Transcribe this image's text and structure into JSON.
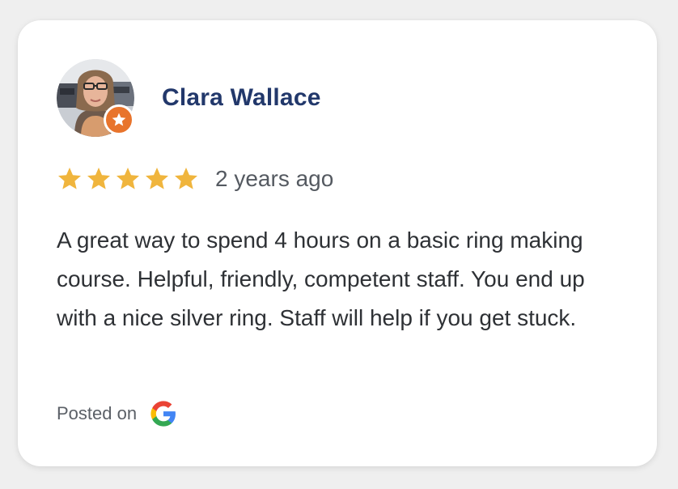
{
  "review": {
    "reviewer_name": "Clara Wallace",
    "avatar_icon": "reviewer-photo",
    "badge_icon": "local-guide-star-icon",
    "badge_color": "#e8742c",
    "rating": 5,
    "rating_max": 5,
    "star_color": "#f0b53d",
    "time_ago": "2 years ago",
    "text": "A great way to spend 4 hours on a basic ring making course. Helpful, friendly, competent staff. You end up with a nice silver ring. Staff will help if you get stuck.",
    "posted_on_label": "Posted on",
    "source_icon": "google-icon"
  }
}
